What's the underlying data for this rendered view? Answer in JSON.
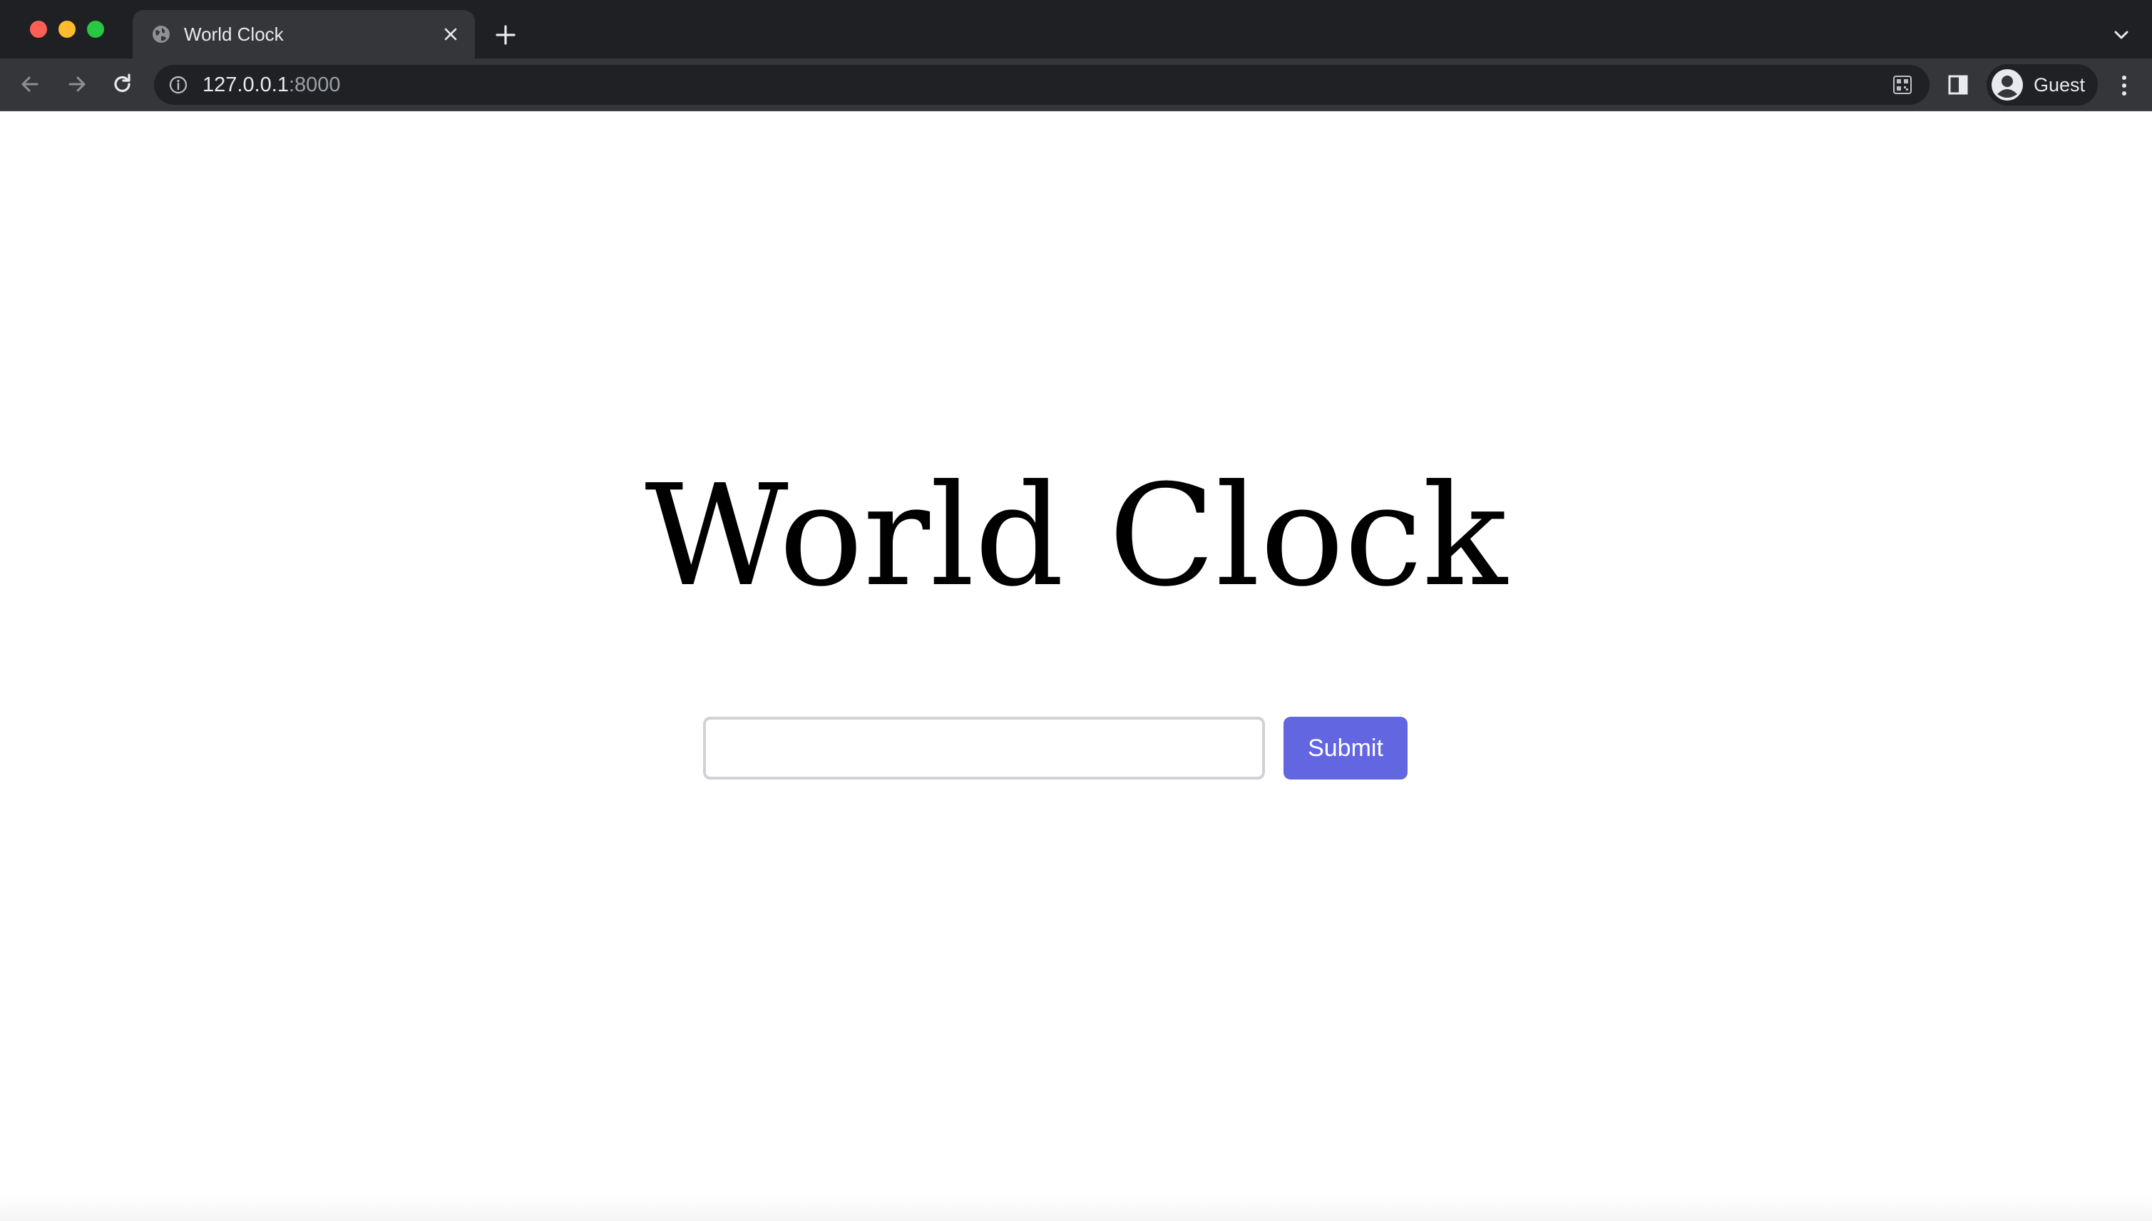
{
  "browser": {
    "tab": {
      "title": "World Clock",
      "favicon": "globe-icon"
    },
    "address_bar": {
      "host": "127.0.0.1",
      "port": ":8000"
    },
    "profile": {
      "name": "Guest"
    },
    "icons": {
      "back": "arrow-left-icon",
      "forward": "arrow-right-icon",
      "reload": "reload-icon",
      "info": "info-icon",
      "qr": "qr-code-icon",
      "side_panel": "side-panel-icon",
      "menu": "kebab-menu-icon",
      "tab_search": "chevron-down-icon",
      "new_tab": "plus-icon",
      "close_tab": "close-icon"
    }
  },
  "page": {
    "title": "World Clock",
    "input": {
      "value": "",
      "placeholder": ""
    },
    "submit_label": "Submit"
  },
  "colors": {
    "accent": "#6366e1",
    "chrome_dark": "#202124",
    "chrome_toolbar": "#35363a"
  }
}
